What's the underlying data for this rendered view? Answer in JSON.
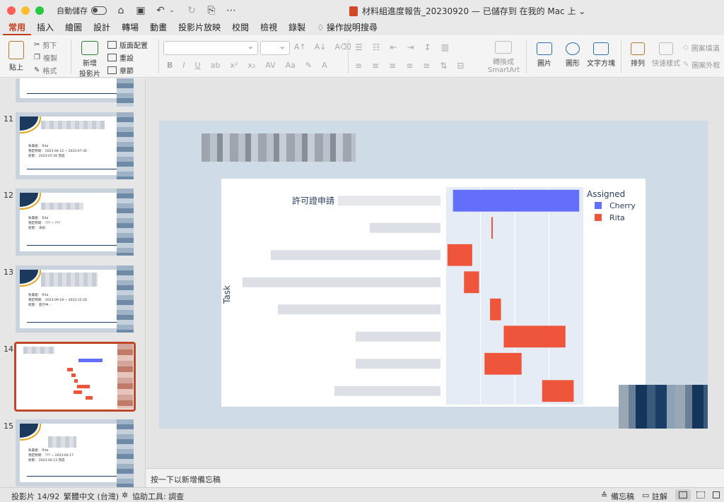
{
  "window": {
    "autosave_label": "自動儲存",
    "doc_title": "材料組進度報告_20230920 — 已儲存到 在我的 Mac 上 ⌄"
  },
  "ribbon_tabs": [
    "常用",
    "插入",
    "繪圖",
    "設計",
    "轉場",
    "動畫",
    "投影片放映",
    "校閱",
    "檢視",
    "錄製"
  ],
  "tell_me": "操作說明搜尋",
  "ribbon": {
    "paste": "貼上",
    "cut": "剪下",
    "copy": "複製",
    "format": "格式",
    "new_slide_1": "新增",
    "new_slide_2": "投影片",
    "layout": "版面配置",
    "reset": "重設",
    "section": "章節",
    "smartart_1": "轉換成",
    "smartart_2": "SmartArt",
    "picture": "圖片",
    "shapes": "圖形",
    "textbox": "文字方塊",
    "arrange": "排列",
    "quick_styles": "快速樣式",
    "shape_fill": "圖案填滿",
    "shape_outline": "圖案外框"
  },
  "thumbnails": [
    {
      "num": "11",
      "lines": [
        "負責組： Rita",
        "預定時間： 2023-04-12 ~ 2023-07-30",
        "狀態： 2023-07-26 完成"
      ]
    },
    {
      "num": "12",
      "lines": [
        "負責組： Rita",
        "預定時間： ??? ~ ???",
        "狀態： 未知"
      ]
    },
    {
      "num": "13",
      "lines": [
        "負責組： Rita",
        "預定時間： 2023-09-18 ~ 2023-12-20",
        "狀態： 進行中..."
      ]
    },
    {
      "num": "14",
      "lines": []
    },
    {
      "num": "15",
      "lines": [
        "負責組： Rita",
        "預定時間： ??? ~ 2023-04-17",
        "狀態： 2023-04-13 完成"
      ]
    }
  ],
  "chart_data": {
    "type": "bar",
    "orientation": "horizontal-gantt",
    "ylabel": "Task",
    "categories": [
      "許可證申請",
      "",
      "",
      "",
      "",
      "",
      "",
      ""
    ],
    "legend_title": "Assigned",
    "legend_position": "top-right",
    "series": [
      {
        "name": "Cherry",
        "color": "#636efa",
        "bars": [
          {
            "task": 0,
            "start": 0.05,
            "end": 0.97
          }
        ]
      },
      {
        "name": "Rita",
        "color": "#ef553b",
        "bars": [
          {
            "task": 1,
            "start": 0.33,
            "end": 0.34
          },
          {
            "task": 2,
            "start": 0.01,
            "end": 0.19
          },
          {
            "task": 3,
            "start": 0.13,
            "end": 0.24
          },
          {
            "task": 4,
            "start": 0.32,
            "end": 0.4
          },
          {
            "task": 5,
            "start": 0.42,
            "end": 0.87
          },
          {
            "task": 6,
            "start": 0.28,
            "end": 0.55
          },
          {
            "task": 7,
            "start": 0.7,
            "end": 0.93
          }
        ]
      }
    ]
  },
  "notes_placeholder": "按一下以新增備忘稿",
  "status": {
    "slide_pos": "投影片 14/92",
    "language": "繁體中文 (台灣)",
    "accessibility": "協助工具: 調查",
    "notes": "備忘稿",
    "comments": "註解"
  }
}
